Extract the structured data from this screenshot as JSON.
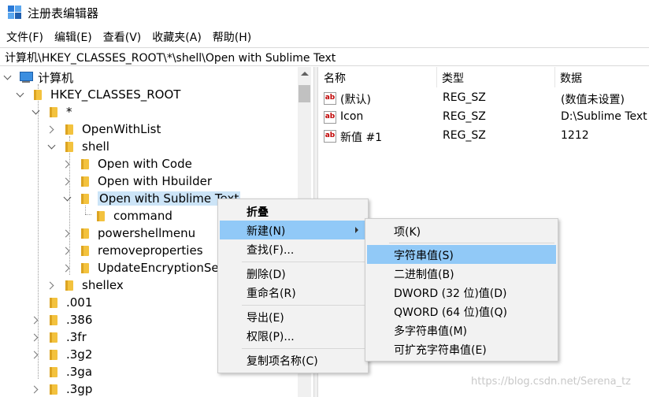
{
  "window": {
    "title": "注册表编辑器"
  },
  "menubar": [
    "文件(F)",
    "编辑(E)",
    "查看(V)",
    "收藏夹(A)",
    "帮助(H)"
  ],
  "address": "计算机\\HKEY_CLASSES_ROOT\\*\\shell\\Open with Sublime Text",
  "tree": {
    "root": "计算机",
    "items": [
      {
        "label": "HKEY_CLASSES_ROOT",
        "state": "open"
      },
      {
        "label": "*",
        "state": "open"
      },
      {
        "label": "OpenWithList",
        "state": "closed"
      },
      {
        "label": "shell",
        "state": "open"
      },
      {
        "label": "Open with Code",
        "state": "closed"
      },
      {
        "label": "Open with Hbuilder",
        "state": "closed"
      },
      {
        "label": "Open with Sublime Text",
        "state": "open"
      },
      {
        "label": "command",
        "state": "none"
      },
      {
        "label": "powershellmenu",
        "state": "closed"
      },
      {
        "label": "removeproperties",
        "state": "closed"
      },
      {
        "label": "UpdateEncryptionSet",
        "state": "closed"
      },
      {
        "label": "shellex",
        "state": "closed"
      },
      {
        "label": ".001",
        "state": "none"
      },
      {
        "label": ".386",
        "state": "closed"
      },
      {
        "label": ".3fr",
        "state": "closed"
      },
      {
        "label": ".3g2",
        "state": "closed"
      },
      {
        "label": ".3ga",
        "state": "none"
      },
      {
        "label": ".3gp",
        "state": "closed"
      }
    ]
  },
  "values": {
    "columns": [
      "名称",
      "类型",
      "数据"
    ],
    "rows": [
      {
        "name": "(默认)",
        "type": "REG_SZ",
        "data": "(数值未设置)"
      },
      {
        "name": "Icon",
        "type": "REG_SZ",
        "data": "D:\\Sublime Text"
      },
      {
        "name": "新值 #1",
        "type": "REG_SZ",
        "data": "1212"
      }
    ]
  },
  "context_menu": {
    "items": [
      "折叠",
      "新建(N)",
      "查找(F)...",
      "删除(D)",
      "重命名(R)",
      "导出(E)",
      "权限(P)...",
      "复制项名称(C)"
    ]
  },
  "submenu": {
    "items": [
      "项(K)",
      "字符串值(S)",
      "二进制值(B)",
      "DWORD (32 位)值(D)",
      "QWORD (64 位)值(Q)",
      "多字符串值(M)",
      "可扩充字符串值(E)"
    ]
  },
  "icons": {
    "app": "registry-grid-icon",
    "value": "ab-string-icon",
    "folder": "folder-icon",
    "computer": "computer-icon"
  },
  "watermark": "https://blog.csdn.net/Serena_tz"
}
